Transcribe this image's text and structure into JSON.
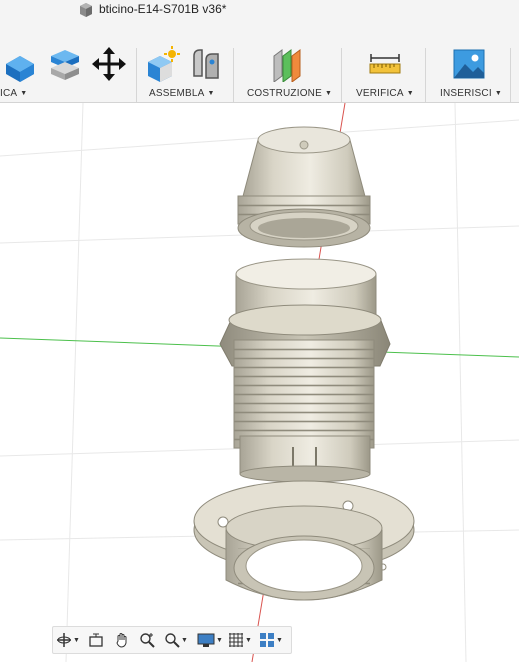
{
  "document": {
    "title": "bticino-E14-S701B v36*"
  },
  "toolbar": {
    "groups": [
      {
        "label": "ICA",
        "icons": [
          "extrude-icon",
          "offset-face-icon",
          "move-icon"
        ]
      },
      {
        "label": "ASSEMBLA",
        "icons": [
          "new-component-icon",
          "joint-icon"
        ]
      },
      {
        "label": "COSTRUZIONE",
        "icons": [
          "offset-plane-icon"
        ]
      },
      {
        "label": "VERIFICA",
        "icons": [
          "measure-icon"
        ]
      },
      {
        "label": "INSERISCI",
        "icons": [
          "insert-image-icon"
        ]
      }
    ]
  },
  "viewport": {
    "model": "bticino E14 lamp holder",
    "parts": [
      "top-cap",
      "threaded-body",
      "flange-ring-nut"
    ]
  },
  "navbar": {
    "tools": [
      "orbit-icon",
      "look-at-icon",
      "pan-icon",
      "zoom-icon",
      "zoom-window-icon",
      "display-settings-icon",
      "grid-settings-icon",
      "viewports-icon"
    ]
  },
  "colors": {
    "toolbar_bg": "#f4f4f4",
    "part_color": "#e4e0d3",
    "axis_red": "#d9534f",
    "axis_green": "#4cc04c",
    "icon_blue": "#2f8ed8"
  }
}
